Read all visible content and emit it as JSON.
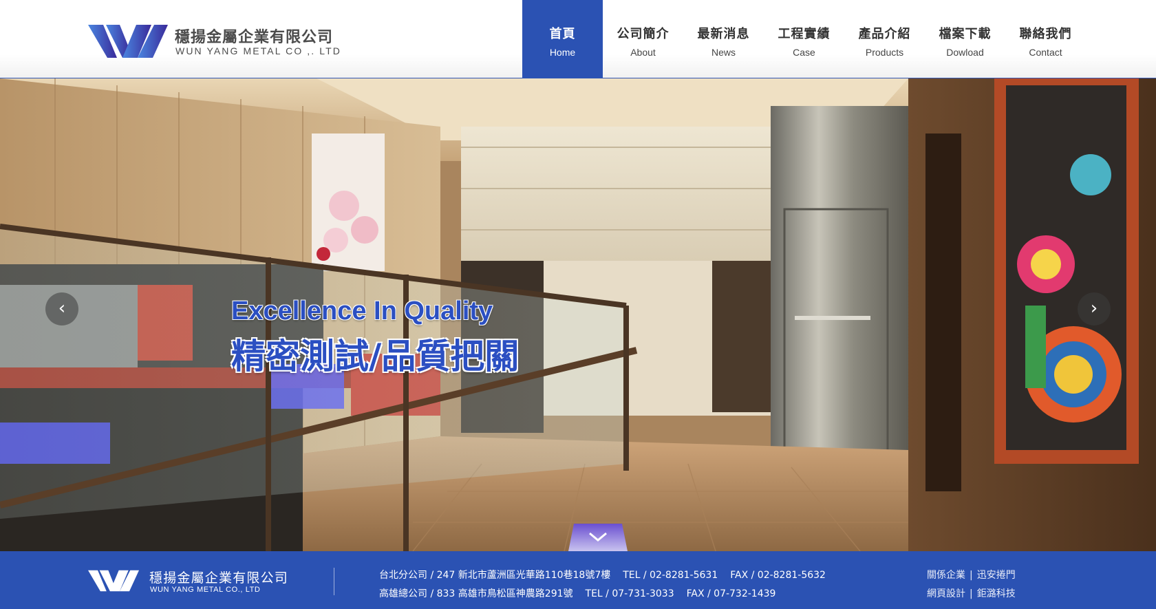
{
  "brand": {
    "name_zh": "穩揚金屬企業有限公司",
    "name_en": "WUN YANG METAL CO ,. LTD"
  },
  "nav": [
    {
      "zh": "首頁",
      "en": "Home",
      "active": true
    },
    {
      "zh": "公司簡介",
      "en": "About",
      "active": false
    },
    {
      "zh": "最新消息",
      "en": "News",
      "active": false
    },
    {
      "zh": "工程實績",
      "en": "Case",
      "active": false
    },
    {
      "zh": "產品介紹",
      "en": "Products",
      "active": false
    },
    {
      "zh": "檔案下載",
      "en": "Dowload",
      "active": false
    },
    {
      "zh": "聯絡我們",
      "en": "Contact",
      "active": false
    }
  ],
  "hero": {
    "title_en": "Excellence In Quality",
    "title_zh": "精密測試/品質把關",
    "prev_icon": "chevron-left-icon",
    "next_icon": "chevron-right-icon",
    "scroll_icon": "chevron-down-icon"
  },
  "footer": {
    "name_zh": "穩揚金屬企業有限公司",
    "name_en": "WUN YANG METAL CO., LTD",
    "taipei": {
      "address": "台北分公司 / 247 新北市蘆洲區光華路110巷18號7樓",
      "tel": "TEL / 02-8281-5631",
      "fax": "FAX / 02-8281-5632"
    },
    "kaohsiung": {
      "address": "高雄總公司 / 833 高雄市鳥松區神農路291號",
      "tel": "TEL / 07-731-3033",
      "fax": "FAX / 07-732-1439"
    },
    "links": [
      [
        "關係企業",
        "迅安捲門"
      ],
      [
        "網頁設計",
        "鉅潞科技"
      ]
    ],
    "link_separator": "|"
  },
  "colors": {
    "primary_blue": "#2b52b3",
    "logo_blue": "#3b6fd4",
    "logo_purple": "#3d2a9e"
  }
}
